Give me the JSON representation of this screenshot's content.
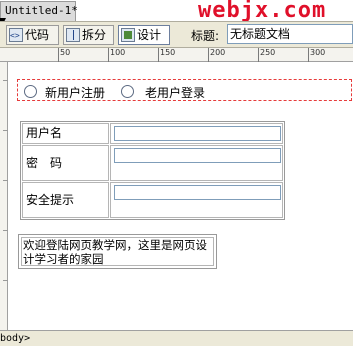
{
  "window": {
    "doc_tab": "Untitled-1*",
    "watermark": "webjx.com"
  },
  "toolbar": {
    "code_label": "代码",
    "split_label": "拆分",
    "design_label": "设计",
    "title_label": "标题:",
    "title_value": "无标题文档"
  },
  "ruler": {
    "labels": [
      "50",
      "100",
      "150",
      "200",
      "250",
      "300"
    ]
  },
  "form": {
    "radio_new": "新用户注册",
    "radio_old": "老用户登录"
  },
  "table": {
    "rows": [
      {
        "label": "用户名"
      },
      {
        "label": "密　码"
      },
      {
        "label": "安全提示"
      }
    ]
  },
  "note": {
    "text": "欢迎登陆网页教学网，这里是网页设计学习者的家园"
  },
  "statusbar": {
    "tag": "body>"
  }
}
